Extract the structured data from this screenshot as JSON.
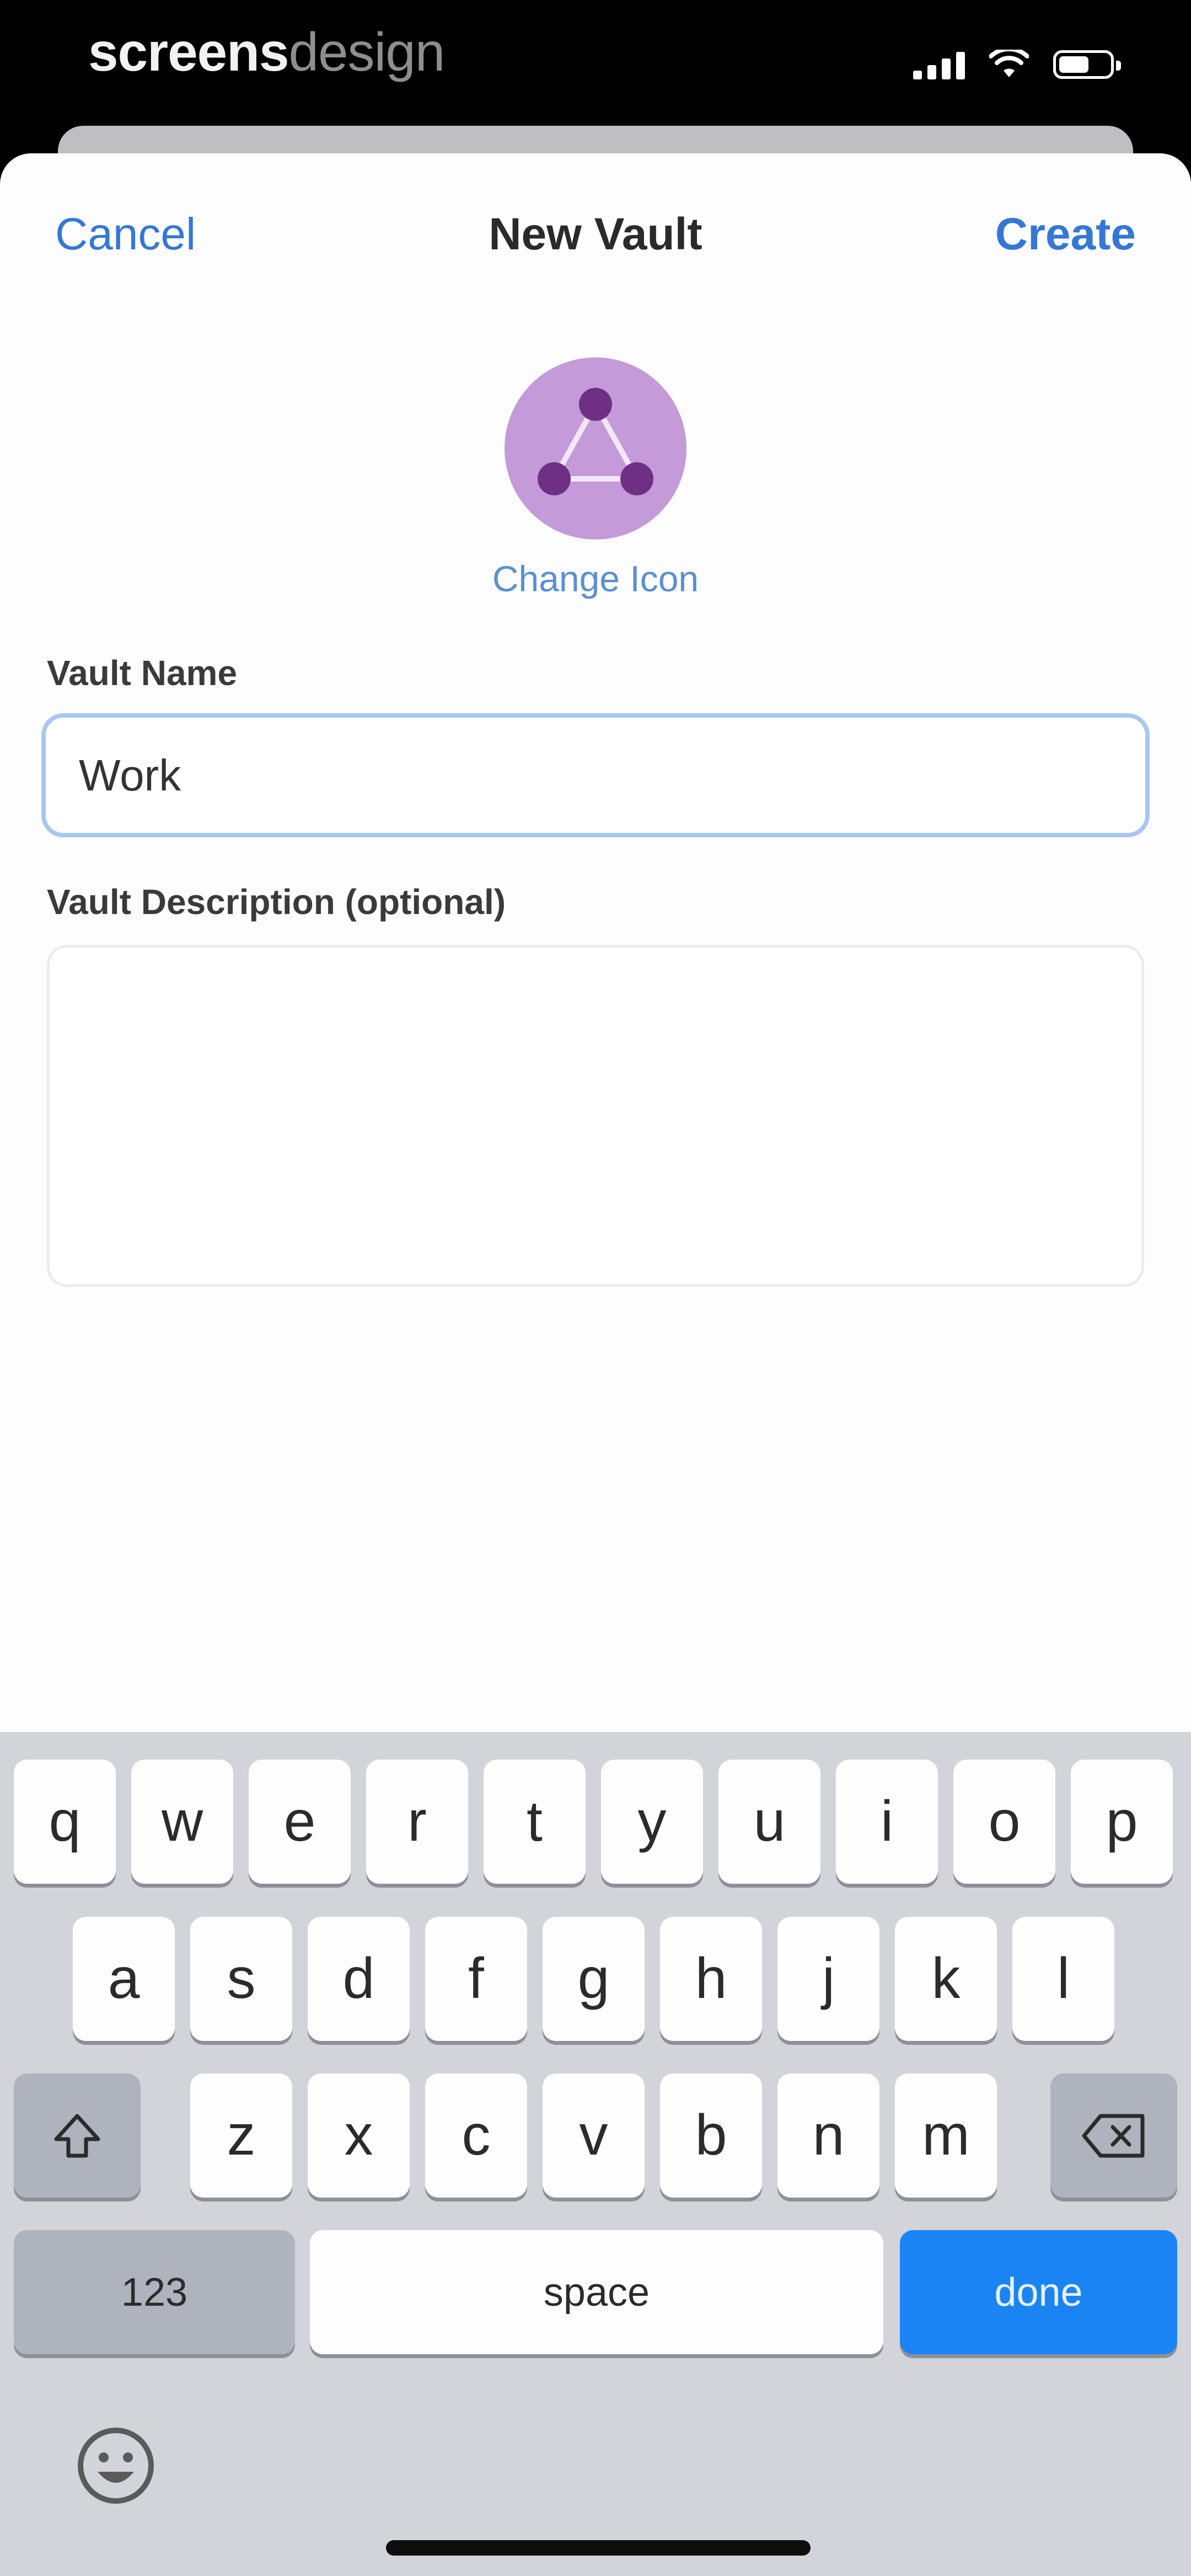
{
  "status_bar": {
    "brand_bold": "screens",
    "brand_light": "design",
    "battery_level": 0.6
  },
  "nav": {
    "cancel_label": "Cancel",
    "title": "New Vault",
    "create_label": "Create"
  },
  "vault_icon": {
    "icon_name": "network-triangle-icon",
    "background_color": "#c49ad9",
    "node_color": "#6e2f84"
  },
  "change_icon_label": "Change Icon",
  "form": {
    "name_label": "Vault Name",
    "name_value": "Work",
    "description_label": "Vault Description (optional)",
    "description_value": ""
  },
  "keyboard": {
    "row1": [
      "q",
      "w",
      "e",
      "r",
      "t",
      "y",
      "u",
      "i",
      "o",
      "p"
    ],
    "row2": [
      "a",
      "s",
      "d",
      "f",
      "g",
      "h",
      "j",
      "k",
      "l"
    ],
    "row3": [
      "z",
      "x",
      "c",
      "v",
      "b",
      "n",
      "m"
    ],
    "numbers_label": "123",
    "space_label": "space",
    "done_label": "done",
    "done_color": "#1a84f5"
  },
  "colors": {
    "accent": "#3478d4",
    "focus_border": "#a9c6f3"
  }
}
